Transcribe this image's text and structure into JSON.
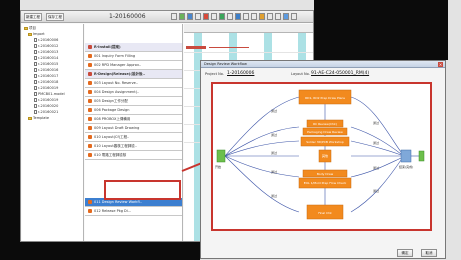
{
  "toolbar": {
    "btn1": "新建工程",
    "btn2": "保存工程",
    "project_title": "1-20160006"
  },
  "tree": {
    "root": "项目",
    "group": "Import",
    "items": [
      "r-20160006",
      "r-20160012",
      "r-20160013",
      "r-20160014",
      "r-20160015",
      "r-20160016",
      "r-20160017",
      "r-20160018",
      "r-20160019",
      "PMCB01-model",
      "r-20160019",
      "r-20160020",
      "r-20160021"
    ],
    "template": "Template"
  },
  "tasks": {
    "rows": [
      "R-Install(提案)",
      "001 Inquiry Form Filling",
      "002 RPD Manager Approv..",
      "R-Design(Release)(設計後..",
      "003 Layout No. Reserve..",
      "004 Design Assignment(..",
      "005 Design工作分配",
      "006 Package Design",
      "008 PROBOX上傳備用",
      "009 Layout Draft Drawing",
      "010 Layout(Cf)工程..",
      "010 Layout審核工程師檢..",
      "010 電路工程師檢核",
      "011 Design Review Workfl..",
      "012 Release Pkg Di..."
    ]
  },
  "dialog": {
    "title": "Design Review Workflow",
    "project_label": "Project No.",
    "project_value": "1-20160006",
    "layout_label": "Layout No.",
    "layout_value": "91-AE-C24-050001_RM(4)",
    "ok": "确定",
    "cancel": "取消"
  },
  "flow": {
    "start_label": "开始",
    "nodes": [
      "RD1, RD2 Prep Draw Plans",
      "RC Review(Chk)",
      "Packaging Draw Review",
      "Solder 3D/PCB Workshop",
      "其他",
      "Body Draw",
      "EOL 1/Mold Prep Flow Check",
      "Final Chk"
    ],
    "end_node": "结束(完成)",
    "edge_label": "通过"
  }
}
